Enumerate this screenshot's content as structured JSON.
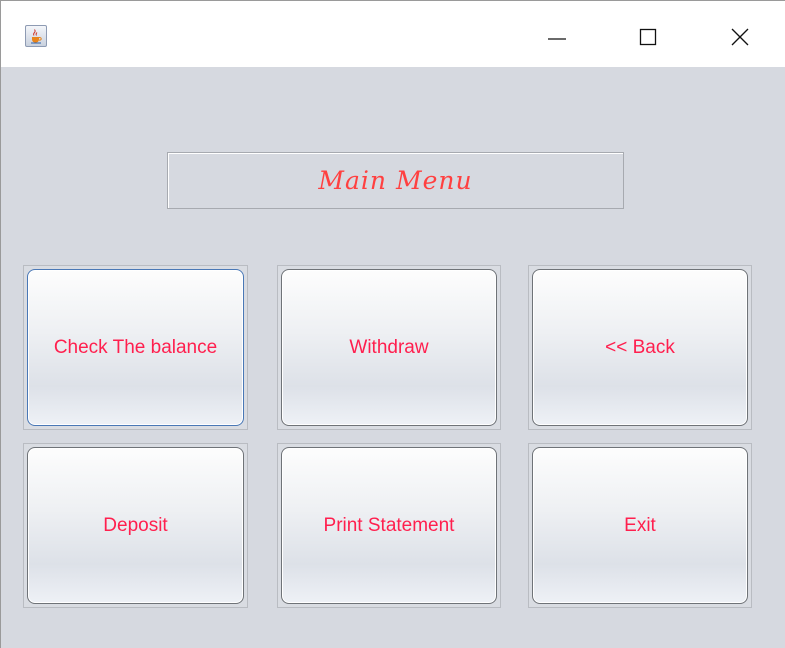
{
  "window": {
    "title": "",
    "app_icon": "java-cup-icon",
    "controls": [
      "minimize-icon",
      "maximize-icon",
      "close-icon"
    ]
  },
  "main": {
    "heading": "Main Menu",
    "buttons": [
      {
        "label": "Check The balance",
        "focused": true
      },
      {
        "label": "Withdraw"
      },
      {
        "label": "<< Back"
      },
      {
        "label": "Deposit"
      },
      {
        "label": "Print Statement"
      },
      {
        "label": "Exit"
      }
    ]
  },
  "colors": {
    "background": "#d6d9e0",
    "text_accent": "#ff1f4e",
    "heading_text": "#ff4040",
    "focus_border": "#4a78b6"
  }
}
